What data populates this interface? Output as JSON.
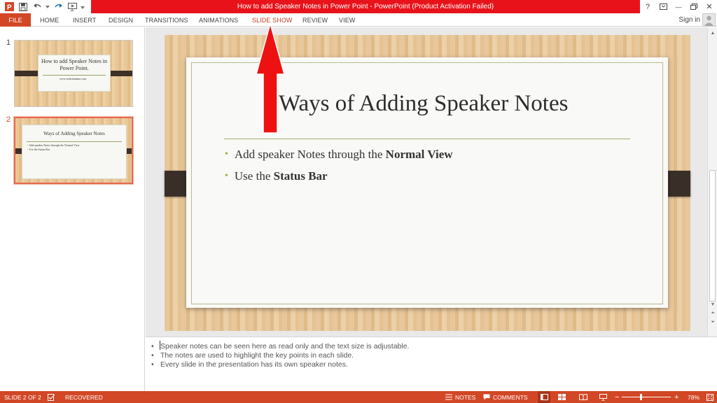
{
  "window": {
    "title": "How to add Speaker Notes in Power Point -  PowerPoint (Product Activation Failed)",
    "help_label": "?",
    "minimize_label": "—",
    "close_label": "✕"
  },
  "ribbon": {
    "tabs": [
      {
        "label": "FILE"
      },
      {
        "label": "HOME"
      },
      {
        "label": "INSERT"
      },
      {
        "label": "DESIGN"
      },
      {
        "label": "TRANSITIONS"
      },
      {
        "label": "ANIMATIONS"
      },
      {
        "label": "SLIDE SHOW",
        "active": true
      },
      {
        "label": "REVIEW"
      },
      {
        "label": "VIEW"
      }
    ],
    "sign_in": "Sign in"
  },
  "thumbnails": [
    {
      "number": "1",
      "title": "How to add Speaker Notes in Power Point.",
      "subtitle": "www.websitename.com"
    },
    {
      "number": "2",
      "title": "Ways of Adding Speaker Notes",
      "bullets": [
        "Add speaker Notes through the Normal View",
        "Use the Status Bar"
      ],
      "selected": true
    }
  ],
  "slide": {
    "title": "Ways of Adding Speaker Notes",
    "bullets": [
      {
        "text": "Add speaker Notes through the ",
        "bold": "Normal View"
      },
      {
        "text": "Use the ",
        "bold": "Status Bar"
      }
    ],
    "bullet_glyph": "•"
  },
  "notes": {
    "bullet_glyph": "•",
    "lines": [
      "Speaker notes can be seen here as read only and the text size is adjustable.",
      "The notes are used to highlight the key points in each slide.",
      "Every slide in the presentation has its own speaker notes."
    ]
  },
  "statusbar": {
    "slide_indicator": "SLIDE 2 OF 2",
    "recovered": "RECOVERED",
    "notes_label": "NOTES",
    "comments_label": "COMMENTS",
    "zoom_minus": "−",
    "zoom_plus": "+",
    "zoom_level": "78%"
  },
  "colors": {
    "accent": "#d24726",
    "title_bar_red": "#e8131a",
    "arrow_red": "#ee1111"
  }
}
